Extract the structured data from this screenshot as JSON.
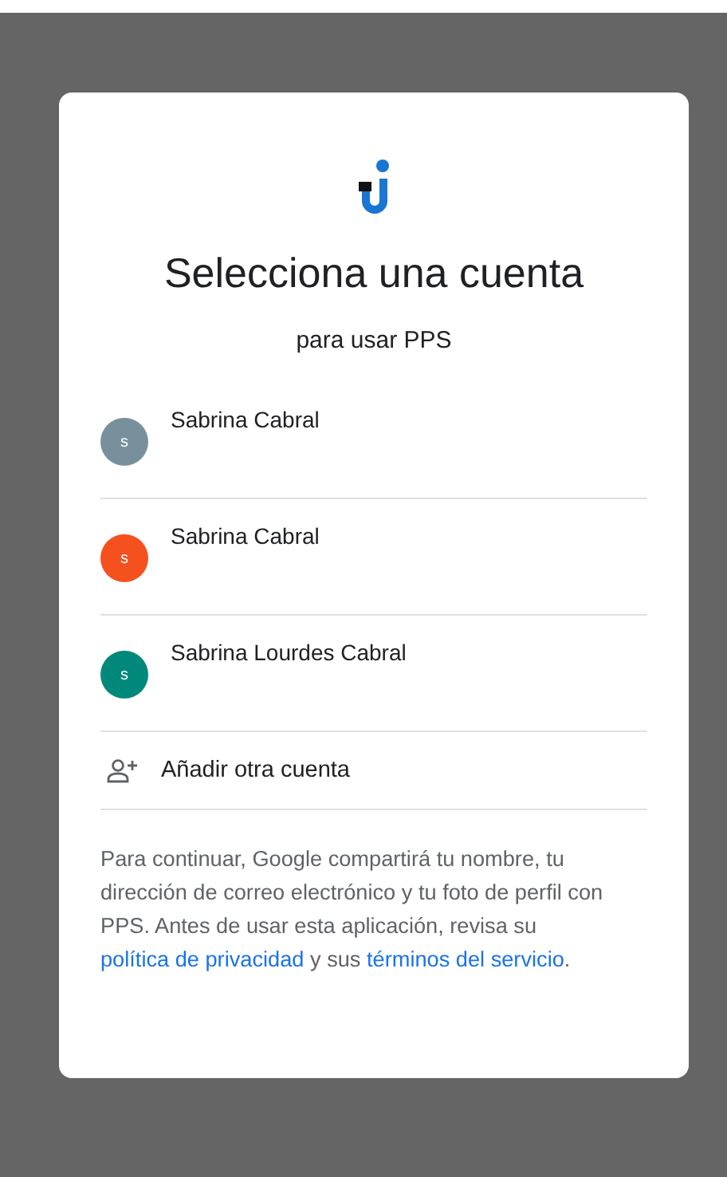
{
  "dialog": {
    "title": "Selecciona una cuenta",
    "subtitle": "para usar PPS"
  },
  "accounts": [
    {
      "name": "Sabrina Cabral",
      "initial": "s",
      "color": "#78909c"
    },
    {
      "name": "Sabrina Cabral",
      "initial": "s",
      "color": "#f4511e"
    },
    {
      "name": "Sabrina Lourdes Cabral",
      "initial": "s",
      "color": "#00897b"
    }
  ],
  "add_account": {
    "label": "Añadir otra cuenta"
  },
  "disclaimer": [
    {
      "kind": "text",
      "text": "Para continuar, Google compartirá tu nombre, tu dirección de correo electrónico y tu foto de perfil con PPS. Antes de usar esta aplicación, revisa su "
    },
    {
      "kind": "link",
      "text": "política de privacidad"
    },
    {
      "kind": "text",
      "text": " y sus "
    },
    {
      "kind": "link",
      "text": "términos del servicio"
    },
    {
      "kind": "text",
      "text": "."
    }
  ]
}
